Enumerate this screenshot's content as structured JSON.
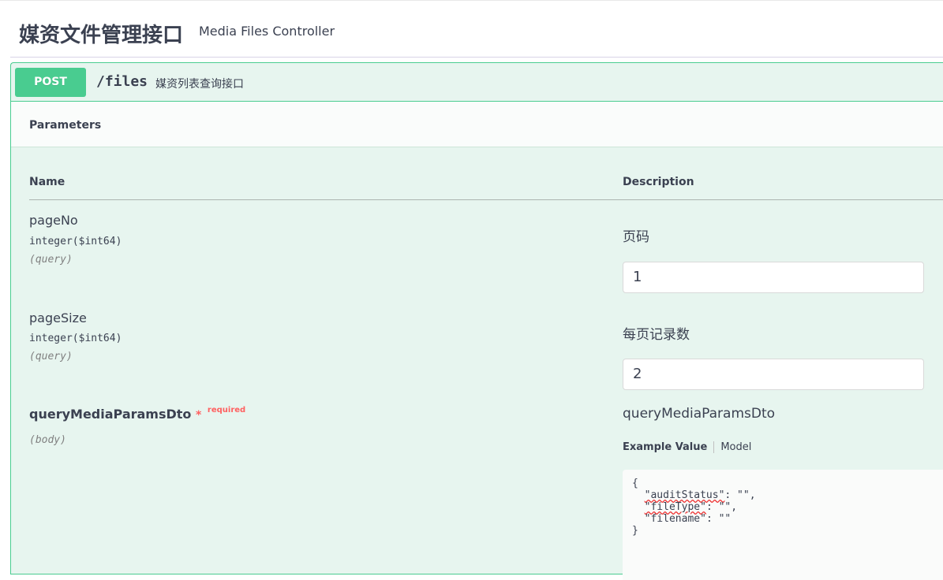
{
  "tag": {
    "title": "媒资文件管理接口",
    "description": "Media Files Controller"
  },
  "operation": {
    "method": "POST",
    "path": "/files",
    "summary": "媒资列表查询接口",
    "method_color": "#49cc90"
  },
  "parameters": {
    "section_title": "Parameters",
    "columns": {
      "name": "Name",
      "description": "Description"
    },
    "items": [
      {
        "name": "pageNo",
        "type": "integer($int64)",
        "in": "(query)",
        "description": "页码",
        "value": "1"
      },
      {
        "name": "pageSize",
        "type": "integer($int64)",
        "in": "(query)",
        "description": "每页记录数",
        "value": "2"
      },
      {
        "name": "queryMediaParamsDto",
        "required_star": "*",
        "required_label": "required",
        "in": "(body)",
        "description": "queryMediaParamsDto"
      }
    ]
  },
  "body_example": {
    "tab_example": "Example Value",
    "tab_model": "Model",
    "line_open": "{",
    "line_key1": "\"auditStatus\"",
    "line_rest1": ": \"\",",
    "line_key2": "\"fileType\"",
    "line_rest2": ": \"\",",
    "line_key3": "\"filename\"",
    "line_rest3": ": \"\"",
    "line_close": "}"
  }
}
